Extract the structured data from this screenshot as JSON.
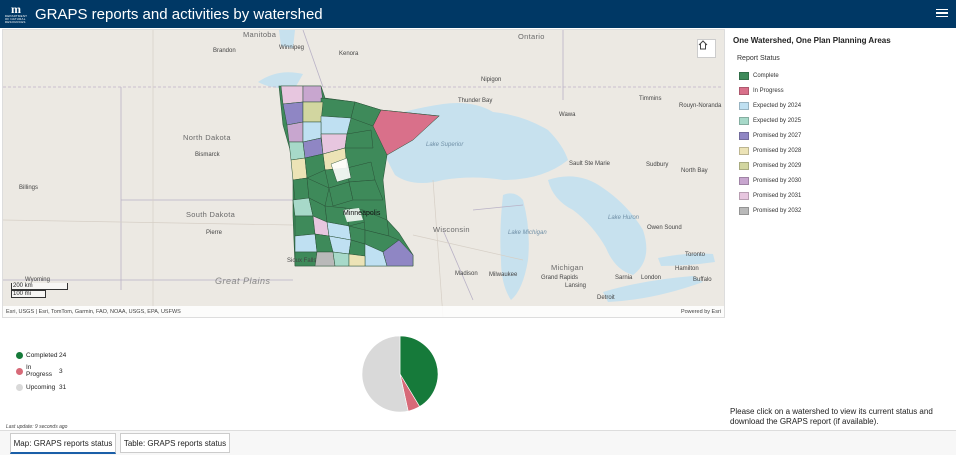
{
  "header": {
    "title": "GRAPS reports and activities by watershed",
    "logo_mark": "m",
    "logo_text": "DEPARTMENT OF NATURAL RESOURCES",
    "bg": "#003865"
  },
  "map": {
    "labels": {
      "ontario": "Ontario",
      "manitoba": "Manitoba",
      "brandon": "Brandon",
      "winnipeg": "Winnipeg",
      "kenora": "Kenora",
      "nipigon": "Nipigon",
      "thunder_bay": "Thunder Bay",
      "wawa": "Wawa",
      "timmins": "Timmins",
      "rouyn": "Rouyn-Noranda",
      "north_dakota": "North Dakota",
      "bismarck": "Bismarck",
      "lake_superior": "Lake Superior",
      "sault": "Sault Ste Marie",
      "sudbury": "Sudbury",
      "north_bay": "North Bay",
      "billings": "Billings",
      "south_dakota": "South Dakota",
      "pierre": "Pierre",
      "minneapolis": "Minneapolis",
      "wisconsin": "Wisconsin",
      "lake_michigan": "Lake Michigan",
      "lake_huron": "Lake Huron",
      "owen_sound": "Owen Sound",
      "toronto": "Toronto",
      "sioux_falls": "Sioux Falls",
      "wyoming": "Wyoming",
      "great_plains": "Great Plains",
      "madison": "Madison",
      "milwaukee": "Milwaukee",
      "michigan": "Michigan",
      "grand_rapids": "Grand Rapids",
      "lansing": "Lansing",
      "sarnia": "Sarnia",
      "london": "London",
      "hamilton": "Hamilton",
      "buffalo": "Buffalo",
      "detroit": "Detroit"
    },
    "scale_km": "200 km",
    "scale_mi": "100 mi",
    "attribution": "Esri, USGS | Esri, TomTom, Garmin, FAO, NOAA, USGS, EPA, USFWS",
    "powered_by": "Powered by Esri",
    "home_icon": "home-icon"
  },
  "legend": {
    "title": "One Watershed, One Plan Planning Areas",
    "subtitle": "Report Status",
    "items": [
      {
        "label": "Complete",
        "color": "#3e8a5a"
      },
      {
        "label": "In Progress",
        "color": "#d9708a"
      },
      {
        "label": "Expected by 2024",
        "color": "#bfe0f2"
      },
      {
        "label": "Expected by 2025",
        "color": "#a7d9c9"
      },
      {
        "label": "Promised by 2027",
        "color": "#8f86c4"
      },
      {
        "label": "Promised by 2028",
        "color": "#ece3b6"
      },
      {
        "label": "Promised by 2029",
        "color": "#d2d6a0"
      },
      {
        "label": "Promised by 2030",
        "color": "#c8a6cf"
      },
      {
        "label": "Promised by 2031",
        "color": "#e7c6df"
      },
      {
        "label": "Promised by 2032",
        "color": "#b9b9b9"
      }
    ]
  },
  "stats": [
    {
      "label": "Completed",
      "value": "24",
      "color": "#167a3a"
    },
    {
      "label": "In Progress",
      "value": "3",
      "color": "#d76a78"
    },
    {
      "label": "Upcoming",
      "value": "31",
      "color": "#d9d9d9"
    }
  ],
  "note": "Please click on a watershed to view its current status and download the GRAPS report (if available).",
  "updated": "Last update: 9 seconds ago",
  "tabs": [
    {
      "label": "Map: GRAPS reports status",
      "active": true
    },
    {
      "label": "Table: GRAPS reports status",
      "active": false
    }
  ]
}
